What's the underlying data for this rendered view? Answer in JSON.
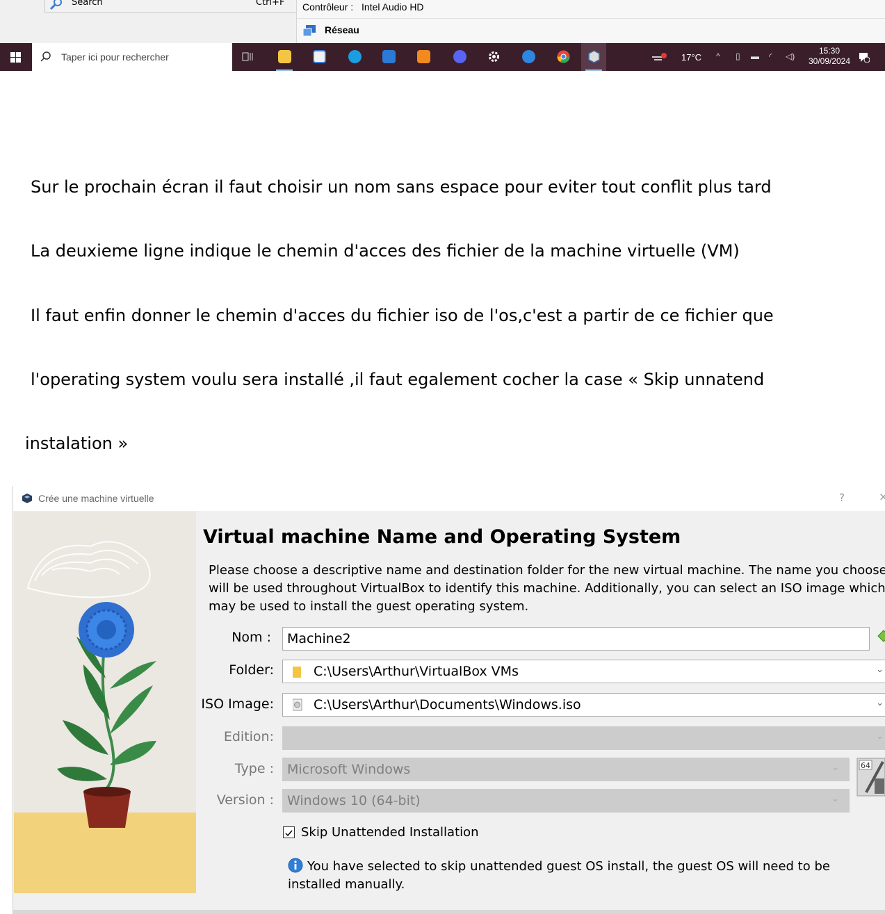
{
  "top": {
    "menu_item": {
      "label": "Search",
      "shortcut": "Ctrl+F"
    },
    "controller": {
      "label": "Contrôleur :",
      "value": "Intel Audio HD"
    },
    "network_label": "Réseau"
  },
  "taskbar": {
    "search_placeholder": "Taper ici pour rechercher",
    "weather": "17°C",
    "time": "15:30",
    "date": "30/09/2024",
    "notification_count": "1",
    "colors": {
      "background": "#3a1f2a",
      "accent": "#9fc3e8"
    }
  },
  "doc": {
    "line1": "Sur le prochain écran il faut choisir un nom sans espace pour eviter tout conflit plus tard",
    "line2": "La deuxieme ligne indique le chemin d'acces des fichier de la machine virtuelle (VM)",
    "line3": "Il faut enfin donner le chemin d'acces du fichier iso de l'os,c'est a partir de ce fichier que",
    "line4": "l'operating system voulu sera installé ,il faut egalement cocher la case « Skip unnatend",
    "line5": "instalation »"
  },
  "dialog": {
    "title": "Crée une machine virtuelle",
    "help": "?",
    "close": "×",
    "heading": "Virtual machine Name and Operating System",
    "description": "Please choose a descriptive name and destination folder for the new virtual machine. The name you choose will be used throughout VirtualBox to identify this machine. Additionally, you can select an ISO image which may be used to install the guest operating system.",
    "fields": {
      "nom": {
        "label": "Nom :",
        "value": "Machine2"
      },
      "folder": {
        "label": "Folder:",
        "value": "C:\\Users\\Arthur\\VirtualBox VMs"
      },
      "iso": {
        "label": "ISO Image:",
        "value": "C:\\Users\\Arthur\\Documents\\Windows.iso"
      },
      "edition": {
        "label": "Edition:",
        "value": ""
      },
      "type": {
        "label": "Type :",
        "value": "Microsoft Windows"
      },
      "version": {
        "label": "Version :",
        "value": "Windows 10 (64-bit)"
      }
    },
    "os_badge": "64",
    "skip_checkbox": {
      "label": "Skip Unattended Installation",
      "checked": true
    },
    "info_text": "You have selected to skip unattended guest OS install, the guest OS will need to be installed manually."
  }
}
